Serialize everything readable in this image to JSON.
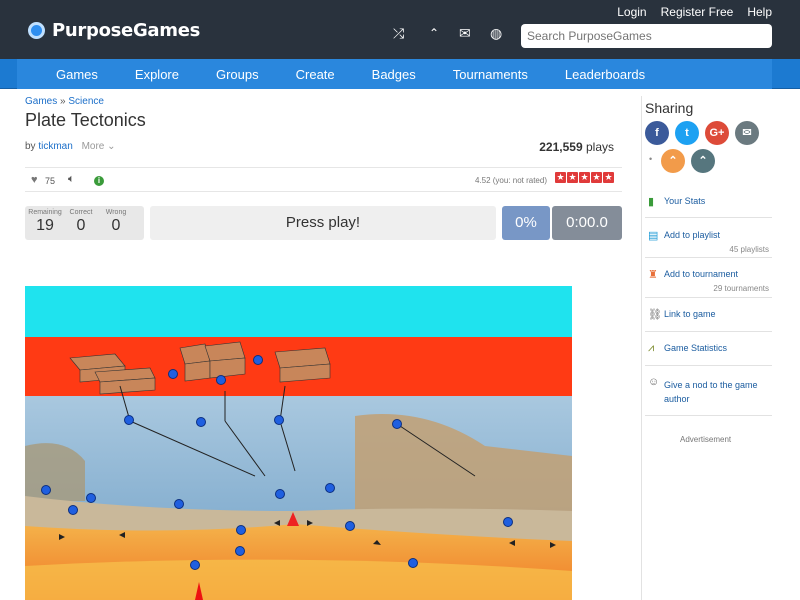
{
  "header": {
    "logo": "PurposeGames",
    "search_placeholder": "Search PurposeGames",
    "links": [
      "Login",
      "Register Free",
      "Help"
    ]
  },
  "nav": [
    "Games",
    "Explore",
    "Groups",
    "Create",
    "Badges",
    "Tournaments",
    "Leaderboards"
  ],
  "breadcrumb": {
    "home": "Games",
    "sep": "»",
    "category": "Science"
  },
  "game": {
    "title": "Plate Tectonics",
    "by": "by",
    "author": "tickman",
    "more": "More",
    "plays_count": "221,559",
    "plays_label": "plays",
    "likes": "75",
    "rating_text": "4.52 (you: not rated)",
    "stars": 5
  },
  "score": {
    "remaining_label": "Remaining",
    "remaining": "19",
    "correct_label": "Correct",
    "correct": "0",
    "wrong_label": "Wrong",
    "wrong": "0",
    "press_play": "Press play!",
    "percent": "0%",
    "timer": "0:00.0"
  },
  "sidebar": {
    "sharing_title": "Sharing",
    "items": [
      {
        "label": "Your Stats",
        "icon": "bar-chart-icon"
      },
      {
        "label": "Add to playlist",
        "sub": "45 playlists",
        "icon": "playlist-icon"
      },
      {
        "label": "Add to tournament",
        "sub": "29 tournaments",
        "icon": "tournament-icon"
      },
      {
        "label": "Link to game",
        "icon": "link-icon"
      },
      {
        "label": "Game Statistics",
        "icon": "chart-line-icon"
      },
      {
        "label": "Give a nod to the game author",
        "icon": "smile-icon"
      }
    ],
    "advertisement": "Advertisement"
  },
  "colors": {
    "topbar": "#29323d",
    "nav": "#2a87dd",
    "link": "#1c6fc9",
    "star": "#e03a3a"
  }
}
